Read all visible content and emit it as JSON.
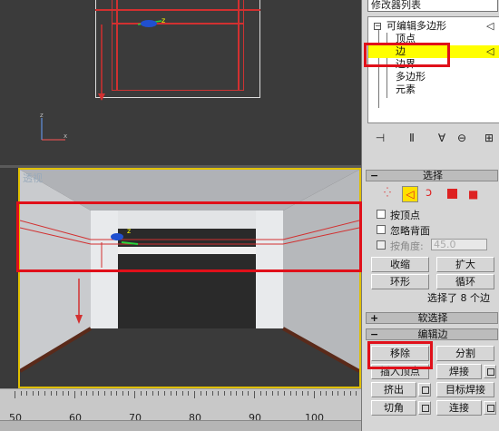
{
  "modifier_list": {
    "label": "修改器列表"
  },
  "stack": {
    "items": [
      {
        "label": "可编辑多边形",
        "level": 0
      },
      {
        "label": "顶点",
        "level": 1
      },
      {
        "label": "边",
        "level": 1,
        "selected": true
      },
      {
        "label": "边界",
        "level": 1
      },
      {
        "label": "多边形",
        "level": 1
      },
      {
        "label": "元素",
        "level": 1
      }
    ]
  },
  "viewport": {
    "label": "透视"
  },
  "selection": {
    "title": "选择",
    "by_vertex": "按顶点",
    "ignore_backfacing": "忽略背面",
    "by_angle": "按角度:",
    "angle_value": "45.0",
    "shrink": "收缩",
    "grow": "扩大",
    "ring": "环形",
    "loop": "循环",
    "status": "选择了 8 个边"
  },
  "soft_selection": {
    "title": "软选择"
  },
  "edit_edges": {
    "title": "编辑边",
    "remove": "移除",
    "split": "分割",
    "insert_vertex": "插入顶点",
    "weld": "焊接",
    "extrude": "挤出",
    "target_weld": "目标焊接",
    "chamfer": "切角",
    "connect": "连接"
  },
  "timeline": {
    "ticks": [
      "50",
      "60",
      "70",
      "80",
      "90",
      "100"
    ]
  },
  "colors": {
    "highlight": "#e0101a",
    "selected_row": "#ffff00",
    "viewport_border": "#e0c000"
  }
}
